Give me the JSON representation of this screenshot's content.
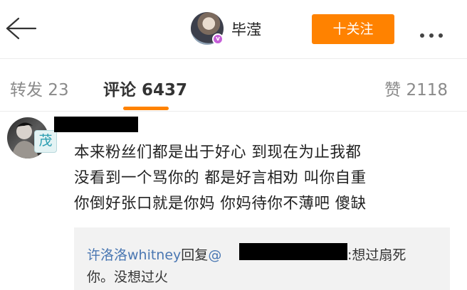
{
  "header": {
    "back_icon": "arrow-left-icon",
    "user_name": "毕滢",
    "follow_label": "十关注",
    "more_icon": "more-horizontal-icon",
    "vip_badge": "v",
    "accent_color": "#ff8200"
  },
  "tabs": {
    "repost": "转发 23",
    "comment": "评论 6437",
    "like": "赞 2118",
    "active": "comment"
  },
  "comment": {
    "avatar_badge": "茂",
    "lines": [
      "本来粉丝们都是出于好心 到现在为止我都",
      "没看到一个骂你的 都是好言相劝 叫你自重",
      "你倒好张口就是你妈 你妈待你不薄吧 傻缺"
    ],
    "reply": {
      "author": "许洛洛whitney",
      "verb": "回复",
      "at": "@",
      "text_after": ":想过扇死",
      "line2": "你。没想过火"
    }
  }
}
